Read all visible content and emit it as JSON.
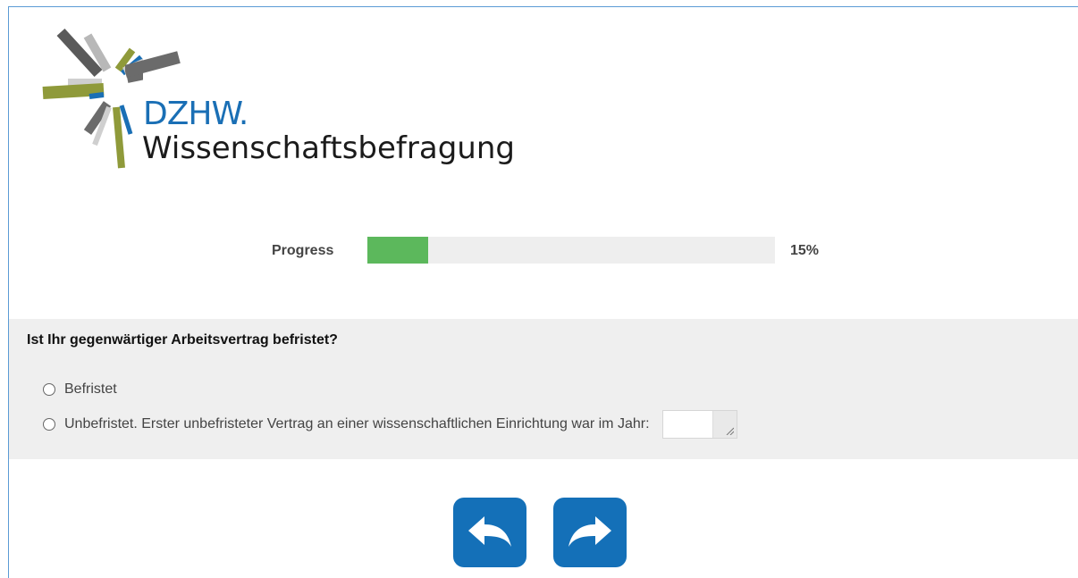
{
  "header": {
    "brand_abbrev": "DZHW.",
    "brand_name": "Wissenschaftsbefragung"
  },
  "progress": {
    "label": "Progress",
    "percent": 15,
    "value_text": "15%",
    "fill_color": "#5cb85c",
    "track_color": "#eeeeee"
  },
  "question": {
    "title": "Ist Ihr gegenwärtiger Arbeitsvertrag befristet?",
    "options": [
      {
        "label": "Befristet",
        "selected": false
      },
      {
        "label": "Unbefristet. Erster unbefristeter Vertrag an einer wissenschaftlichen Einrichtung war im Jahr:",
        "selected": false
      }
    ],
    "year_input_value": ""
  },
  "navigation": {
    "back_icon": "back-arrow-icon",
    "next_icon": "forward-arrow-icon",
    "button_color": "#1470b8"
  },
  "colors": {
    "brand_blue": "#1a6fb5",
    "frame_border": "#5b9bd5",
    "panel_bg": "#efefef"
  }
}
